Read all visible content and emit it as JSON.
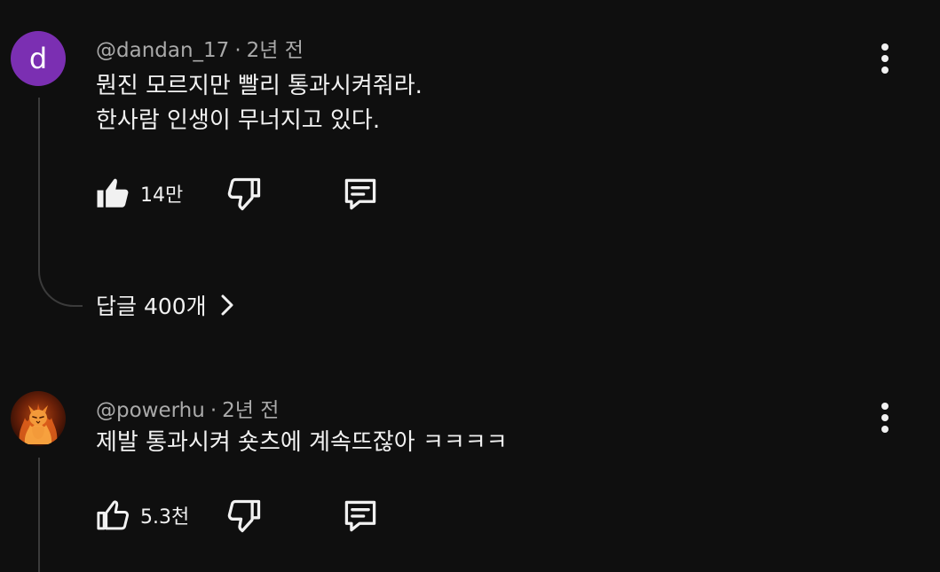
{
  "comments": [
    {
      "avatar_letter": "d",
      "author": "@dandan_17",
      "time": "2년 전",
      "lines": [
        "뭔진 모르지만 빨리 통과시켜줘라.",
        "한사람 인생이 무너지고 있다."
      ],
      "likes": "14만",
      "liked": true,
      "replies_label": "답글 400개",
      "avatar_color": "#7b2fb2"
    },
    {
      "avatar_image": "flaming-cat",
      "author": "@powerhu",
      "time": "2년 전",
      "lines": [
        "제발 통과시켜 숏츠에 계속뜨잖아 ㅋㅋㅋㅋ"
      ],
      "likes": "5.3천",
      "liked": false
    }
  ],
  "separator": "·",
  "icons": {
    "like": "thumbs-up-icon",
    "dislike": "thumbs-down-icon",
    "reply": "comment-icon",
    "more": "more-vertical-icon",
    "expand": "chevron-right-icon"
  },
  "colors": {
    "background": "#0f0f0f",
    "text": "#f1f1f1",
    "meta": "#aaaaaa",
    "thread": "#3b3b3b"
  }
}
